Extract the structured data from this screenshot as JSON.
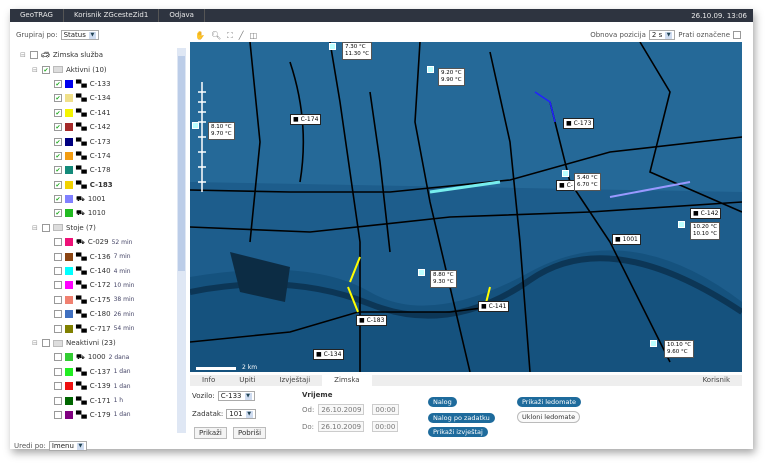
{
  "topbar": {
    "app": "GeoTRAG",
    "user": "Korisnik ZGcesteZid1",
    "logout": "Odjava",
    "datetime": "26.10.09. 13:06"
  },
  "left": {
    "group_label": "Grupiraj po:",
    "group_value": "Status",
    "sort_label": "Uredi po:",
    "sort_value": "Imenu",
    "root": "Zimska služba",
    "groups": [
      {
        "label": "Aktivni (10)",
        "checked": true,
        "items": [
          {
            "name": "C-133",
            "color": "#0000ee",
            "checked": true,
            "icon": "truck"
          },
          {
            "name": "C-134",
            "color": "#f0e08a",
            "checked": true,
            "icon": "truck"
          },
          {
            "name": "C-141",
            "color": "#f5f500",
            "checked": true,
            "icon": "truck"
          },
          {
            "name": "C-142",
            "color": "#a52a2a",
            "checked": true,
            "icon": "truck"
          },
          {
            "name": "C-173",
            "color": "#000080",
            "checked": true,
            "icon": "truck"
          },
          {
            "name": "C-174",
            "color": "#f39c12",
            "checked": true,
            "icon": "truck"
          },
          {
            "name": "C-178",
            "color": "#138a7a",
            "checked": true,
            "icon": "truck"
          },
          {
            "name": "C-183",
            "color": "#f2d200",
            "checked": true,
            "icon": "truck",
            "bold": true
          },
          {
            "name": "1001",
            "color": "#8080ff",
            "checked": true,
            "icon": "tractor"
          },
          {
            "name": "1010",
            "color": "#22bb22",
            "checked": true,
            "icon": "car"
          }
        ]
      },
      {
        "label": "Stoje (7)",
        "checked": false,
        "items": [
          {
            "name": "C-029",
            "extra": "52 min",
            "color": "#ee1177",
            "icon": "car"
          },
          {
            "name": "C-136",
            "extra": "7 min",
            "color": "#8b4513",
            "icon": "truck"
          },
          {
            "name": "C-140",
            "extra": "4 min",
            "color": "#00ffff",
            "icon": "truck"
          },
          {
            "name": "C-172",
            "extra": "10 min",
            "color": "#ff00ff",
            "icon": "truck"
          },
          {
            "name": "C-175",
            "extra": "38 min",
            "color": "#f08070",
            "icon": "truck"
          },
          {
            "name": "C-180",
            "extra": "26 min",
            "color": "#4070c0",
            "icon": "truck"
          },
          {
            "name": "C-717",
            "extra": "54 min",
            "color": "#808000",
            "icon": "truck"
          }
        ]
      },
      {
        "label": "Neaktivni (23)",
        "checked": false,
        "items": [
          {
            "name": "1000",
            "extra": "2 dana",
            "color": "#33cc33",
            "icon": "car"
          },
          {
            "name": "C-137",
            "extra": "1 dan",
            "color": "#22ee22",
            "icon": "truck"
          },
          {
            "name": "C-139",
            "extra": "1 dan",
            "color": "#ee1111",
            "icon": "truck"
          },
          {
            "name": "C-171",
            "extra": "1 h",
            "color": "#006600",
            "icon": "truck"
          },
          {
            "name": "C-179",
            "extra": "1 dan",
            "color": "#800080",
            "icon": "truck"
          }
        ]
      }
    ]
  },
  "toolbar": {
    "refresh_label": "Obnova pozicija",
    "refresh_value": "2 s",
    "follow_label": "Prati označene"
  },
  "map": {
    "vehicles": [
      "C-174",
      "C-173",
      "C-",
      "C-142",
      "1001",
      "C-141",
      "C-183",
      "C-134"
    ],
    "temps": [
      [
        "7.30 °C",
        "11.30 °C"
      ],
      [
        "9.20 °C",
        "9.90 °C"
      ],
      [
        "8.10 °C",
        "9.70 °C"
      ],
      [
        "5.40 °C",
        "6.70 °C"
      ],
      [
        "10.20 °C",
        "10.10 °C"
      ],
      [
        "8.80 °C",
        "9.30 °C"
      ],
      [
        "10.10 °C",
        "9.60 °C"
      ]
    ],
    "scale": "2 km"
  },
  "tabs": [
    "Info",
    "Upiti",
    "Izvještaji",
    "Zimska"
  ],
  "tab_right": "Korisnik",
  "form": {
    "vozilo_label": "Vozilo:",
    "vozilo": "C-133",
    "zadatak_label": "Zadatak:",
    "zadatak": "101",
    "prikazi": "Prikaži",
    "pobrisi": "Pobriši",
    "vrijeme": "Vrijeme",
    "od_label": "Od:",
    "od_date": "26.10.2009",
    "od_time": "00:00",
    "do_label": "Do:",
    "do_date": "26.10.2009",
    "do_time": "00:00",
    "nalog": "Nalog",
    "nalog_po_zadatku": "Nalog po zadatku",
    "prikazi_izvjestaj": "Prikaži izvještaj",
    "prikazi_ledomate": "Prikaži ledomate",
    "ukloni_ledomate": "Ukloni ledomate"
  }
}
